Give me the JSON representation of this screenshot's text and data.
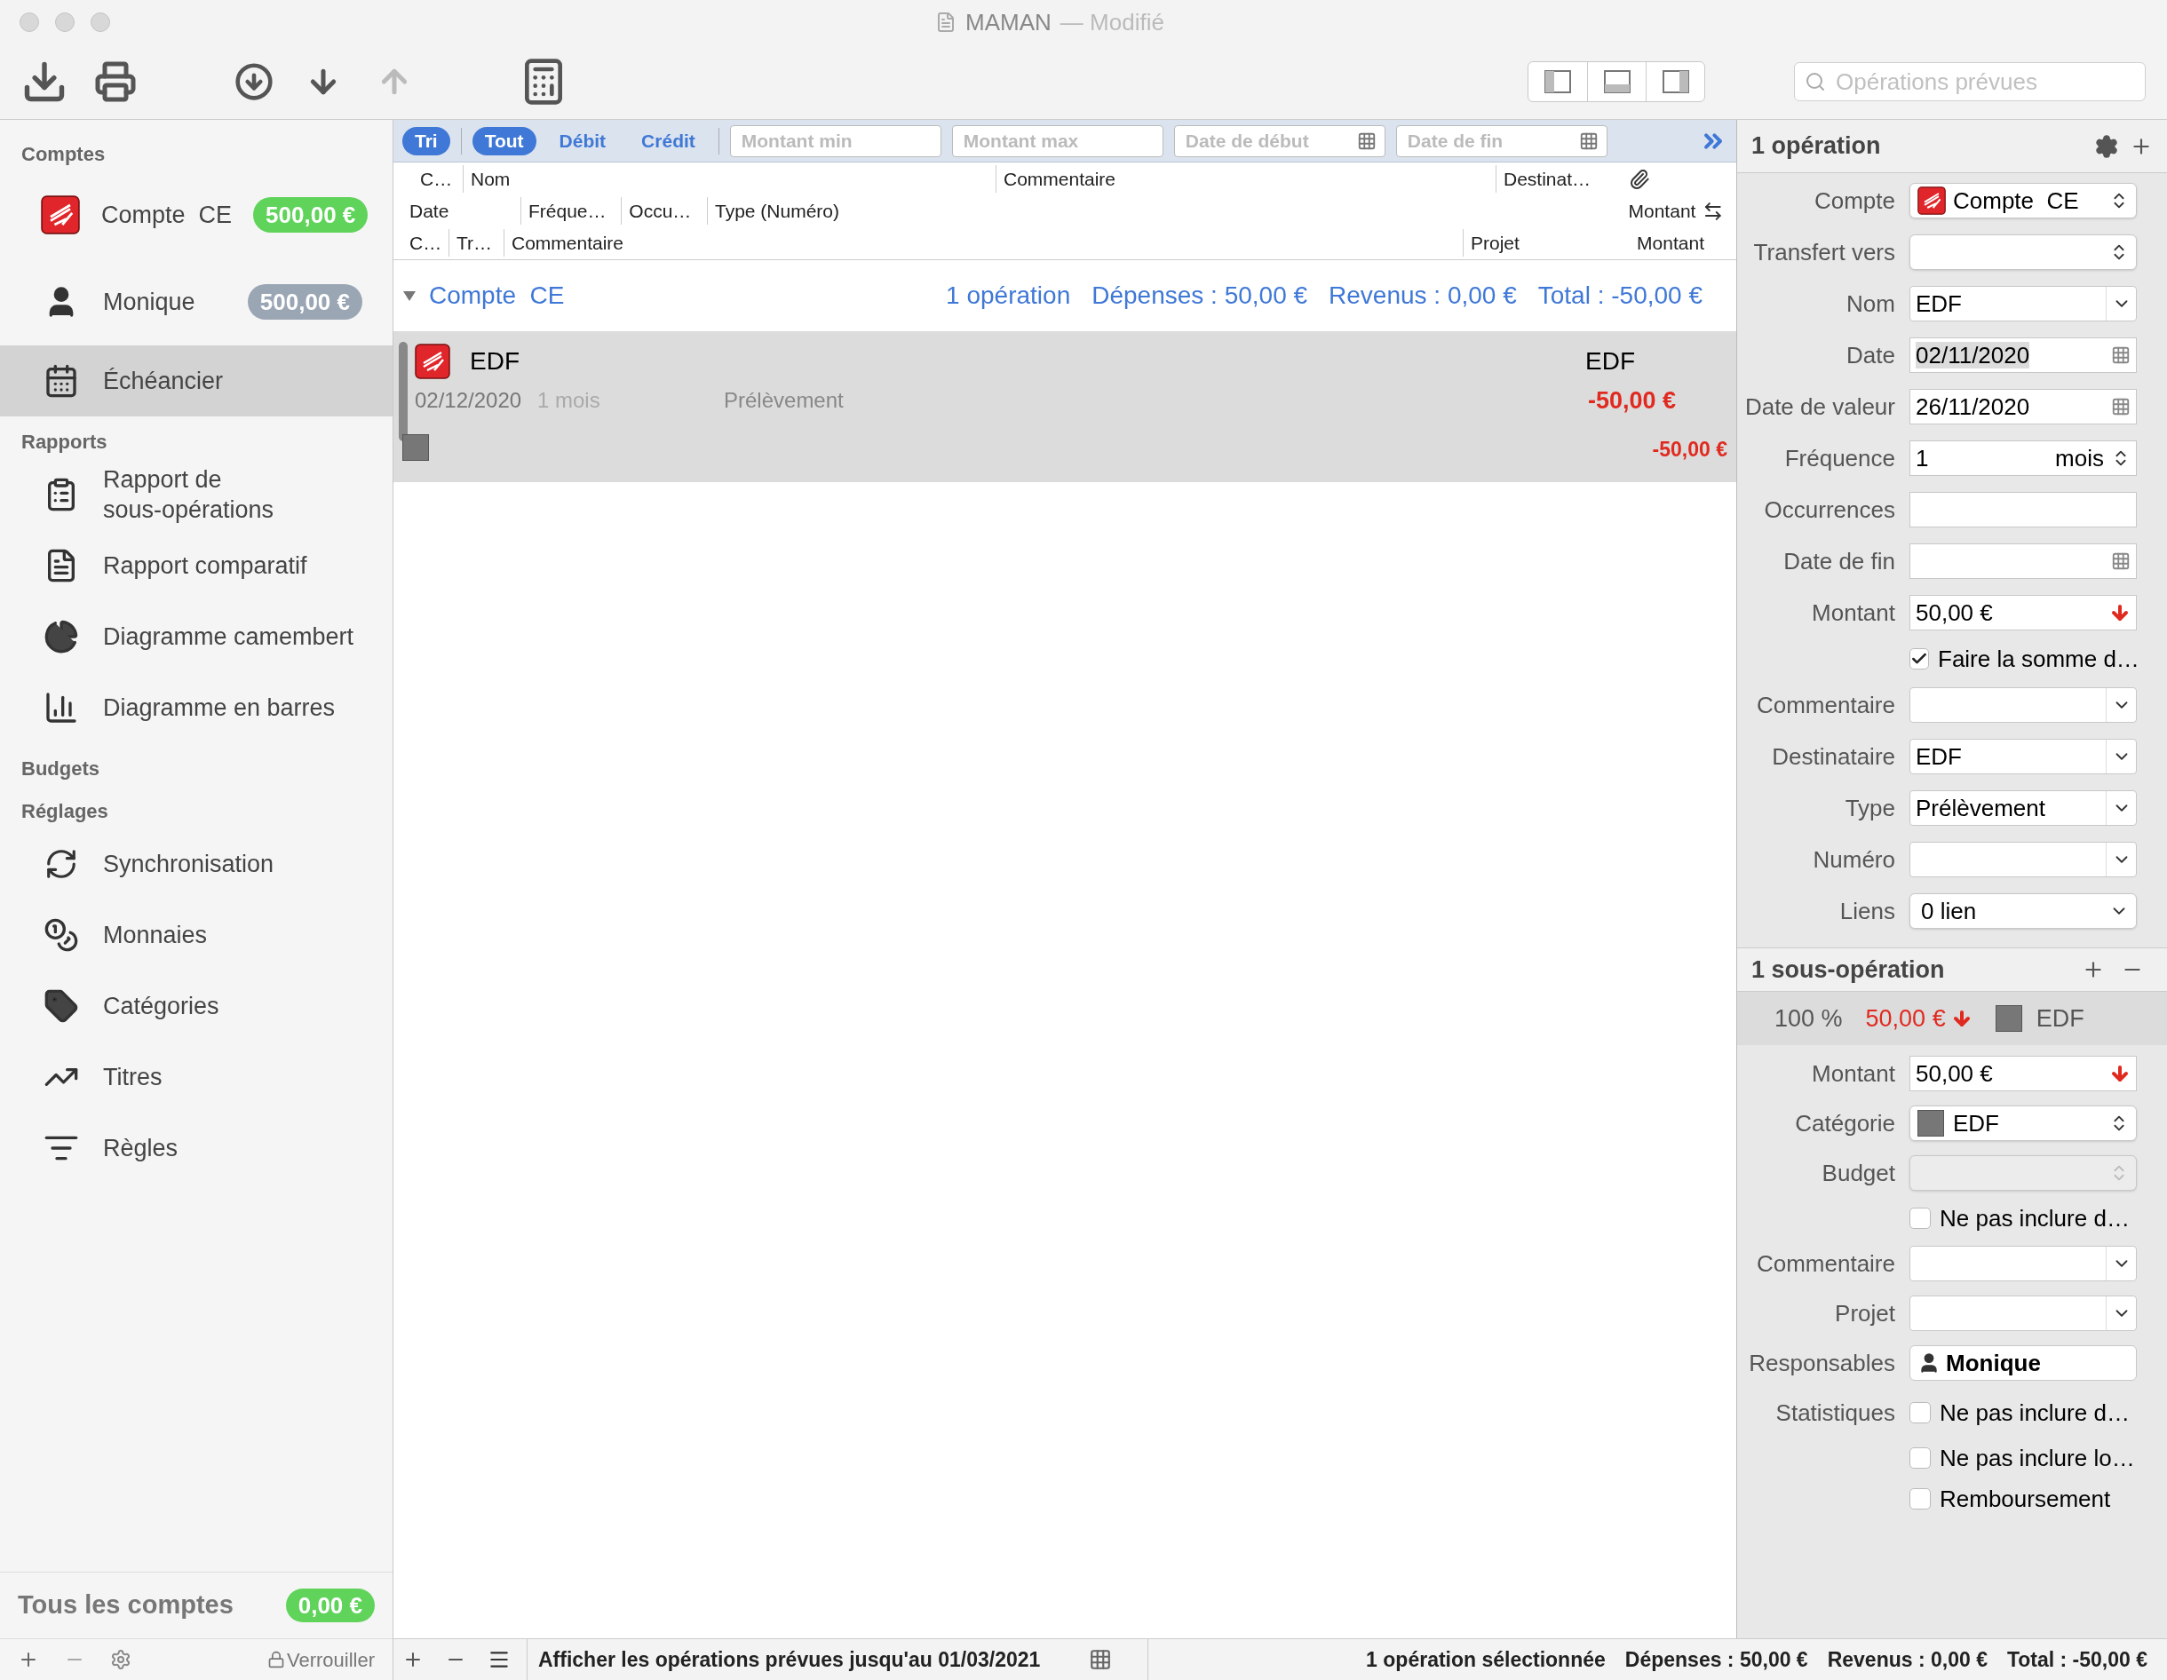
{
  "window": {
    "title": "MAMAN",
    "status": "— Modifié"
  },
  "toolbar": {
    "search": {
      "placeholder": "Opérations prévues"
    }
  },
  "sidebar": {
    "sections": [
      {
        "title": "Comptes",
        "items": [
          {
            "label": "Compte  CE",
            "kind": "bank",
            "badge": "500,00 €",
            "color": "#5fd35a",
            "selected": false
          },
          {
            "label": "Monique",
            "kind": "person",
            "badge": "500,00 €",
            "color": "#9ba6b5",
            "selected": false
          },
          {
            "label": "Échéancier",
            "kind": "calendar",
            "selected": true
          }
        ]
      },
      {
        "title": "Rapports",
        "items": [
          {
            "label": "Rapport de sous-opérations",
            "kind": "report",
            "selected": false
          },
          {
            "label": "Rapport comparatif",
            "kind": "compare",
            "selected": false
          },
          {
            "label": "Diagramme camembert",
            "kind": "pie",
            "selected": false
          },
          {
            "label": "Diagramme en barres",
            "kind": "bars",
            "selected": false
          }
        ]
      },
      {
        "title": "Budgets"
      },
      {
        "title": "Réglages",
        "items": [
          {
            "label": "Synchronisation",
            "kind": "sync",
            "selected": false
          },
          {
            "label": "Monnaies",
            "kind": "coins",
            "selected": false
          },
          {
            "label": "Catégories",
            "kind": "tag",
            "selected": false
          },
          {
            "label": "Titres",
            "kind": "stocks",
            "selected": false
          },
          {
            "label": "Règles",
            "kind": "rules",
            "selected": false
          }
        ]
      }
    ],
    "footer": {
      "label": "Tous les comptes",
      "badge": "0,00 €",
      "lock": "Verrouiller"
    }
  },
  "filter_bar": {
    "sort": "Tri",
    "filters": [
      {
        "label": "Tout",
        "selected": true
      },
      {
        "label": "Débit",
        "selected": false
      },
      {
        "label": "Crédit",
        "selected": false
      }
    ],
    "fields": [
      {
        "placeholder": "Montant min",
        "kind": "text"
      },
      {
        "placeholder": "Montant max",
        "kind": "text"
      },
      {
        "placeholder": "Date de début",
        "kind": "date"
      },
      {
        "placeholder": "Date de fin",
        "kind": "date"
      }
    ]
  },
  "columns": [
    [
      "C…",
      "Nom",
      "Commentaire",
      "Destinat…"
    ],
    [
      "Date",
      "Fréque…",
      "Occu…",
      "Type (Numéro)",
      "Montant"
    ],
    [
      "C…",
      "Tr…",
      "Commentaire",
      "Projet",
      "Montant"
    ]
  ],
  "group": {
    "name": "Compte  CE",
    "expanded": true,
    "count": "1 opération",
    "expenses": "Dépenses : 50,00 €",
    "income": "Revenus : 0,00 €",
    "total": "Total : -50,00 €"
  },
  "operations": [
    {
      "name": "EDF",
      "payee": "EDF",
      "date": "02/12/2020",
      "frequency": "1 mois",
      "type": "Prélèvement",
      "amount": "-50,00 €",
      "split_amount": "-50,00 €",
      "selected": true
    }
  ],
  "list_footer": {
    "text": "Afficher les opérations prévues jusqu'au 01/03/2021",
    "status": [
      "1 opération sélectionnée",
      "Dépenses : 50,00 €",
      "Revenus : 0,00 €",
      "Total : -50,00 €"
    ]
  },
  "inspector": {
    "title": "1 opération",
    "fields": [
      {
        "label": "Compte",
        "kind": "account",
        "value": "Compte  CE"
      },
      {
        "label": "Transfert vers",
        "kind": "stepper"
      },
      {
        "label": "Nom",
        "kind": "combo",
        "value": "EDF"
      },
      {
        "label": "Date",
        "kind": "date",
        "value": "02/11/2020"
      },
      {
        "label": "Date de valeur",
        "kind": "date",
        "value": "26/11/2020"
      },
      {
        "label": "Fréquence",
        "kind": "frequency",
        "value": "1",
        "unit": "mois"
      },
      {
        "label": "Occurrences",
        "kind": "text"
      },
      {
        "label": "Date de fin",
        "kind": "date"
      },
      {
        "label": "Montant",
        "kind": "amount",
        "value": "50,00 €"
      },
      {
        "kind": "check",
        "text": "Faire la somme d…",
        "checked": true
      },
      {
        "label": "Commentaire",
        "kind": "combo"
      },
      {
        "label": "Destinataire",
        "kind": "combo",
        "value": "EDF"
      },
      {
        "label": "Type",
        "kind": "combo",
        "value": "Prélèvement"
      },
      {
        "label": "Numéro",
        "kind": "combo"
      },
      {
        "label": "Liens",
        "kind": "popup",
        "value": "0 lien"
      }
    ],
    "split": {
      "title": "1 sous-opération",
      "percent": "100 %",
      "amount": "50,00 €",
      "category": "EDF",
      "fields": [
        {
          "label": "Montant",
          "kind": "amount",
          "value": "50,00 €",
          "disabled": false
        },
        {
          "label": "Catégorie",
          "kind": "category",
          "value": "EDF",
          "disabled": false
        },
        {
          "label": "Budget",
          "kind": "stepper",
          "disabled": true
        },
        {
          "kind": "check",
          "text": "Ne pas inclure d…",
          "checked": false,
          "disabled": false
        },
        {
          "label": "Commentaire",
          "kind": "combo",
          "disabled": false
        },
        {
          "label": "Projet",
          "kind": "combo",
          "disabled": false
        },
        {
          "label": "Responsables",
          "kind": "person",
          "value": "Monique",
          "disabled": false
        },
        {
          "label": "Statistiques",
          "kind": "check",
          "text": "Ne pas inclure d…",
          "checked": false,
          "disabled": false
        },
        {
          "kind": "check",
          "text": "Ne pas inclure lo…",
          "checked": false,
          "disabled": false
        },
        {
          "kind": "check",
          "text": "Remboursement",
          "checked": false,
          "disabled": false
        }
      ]
    }
  }
}
